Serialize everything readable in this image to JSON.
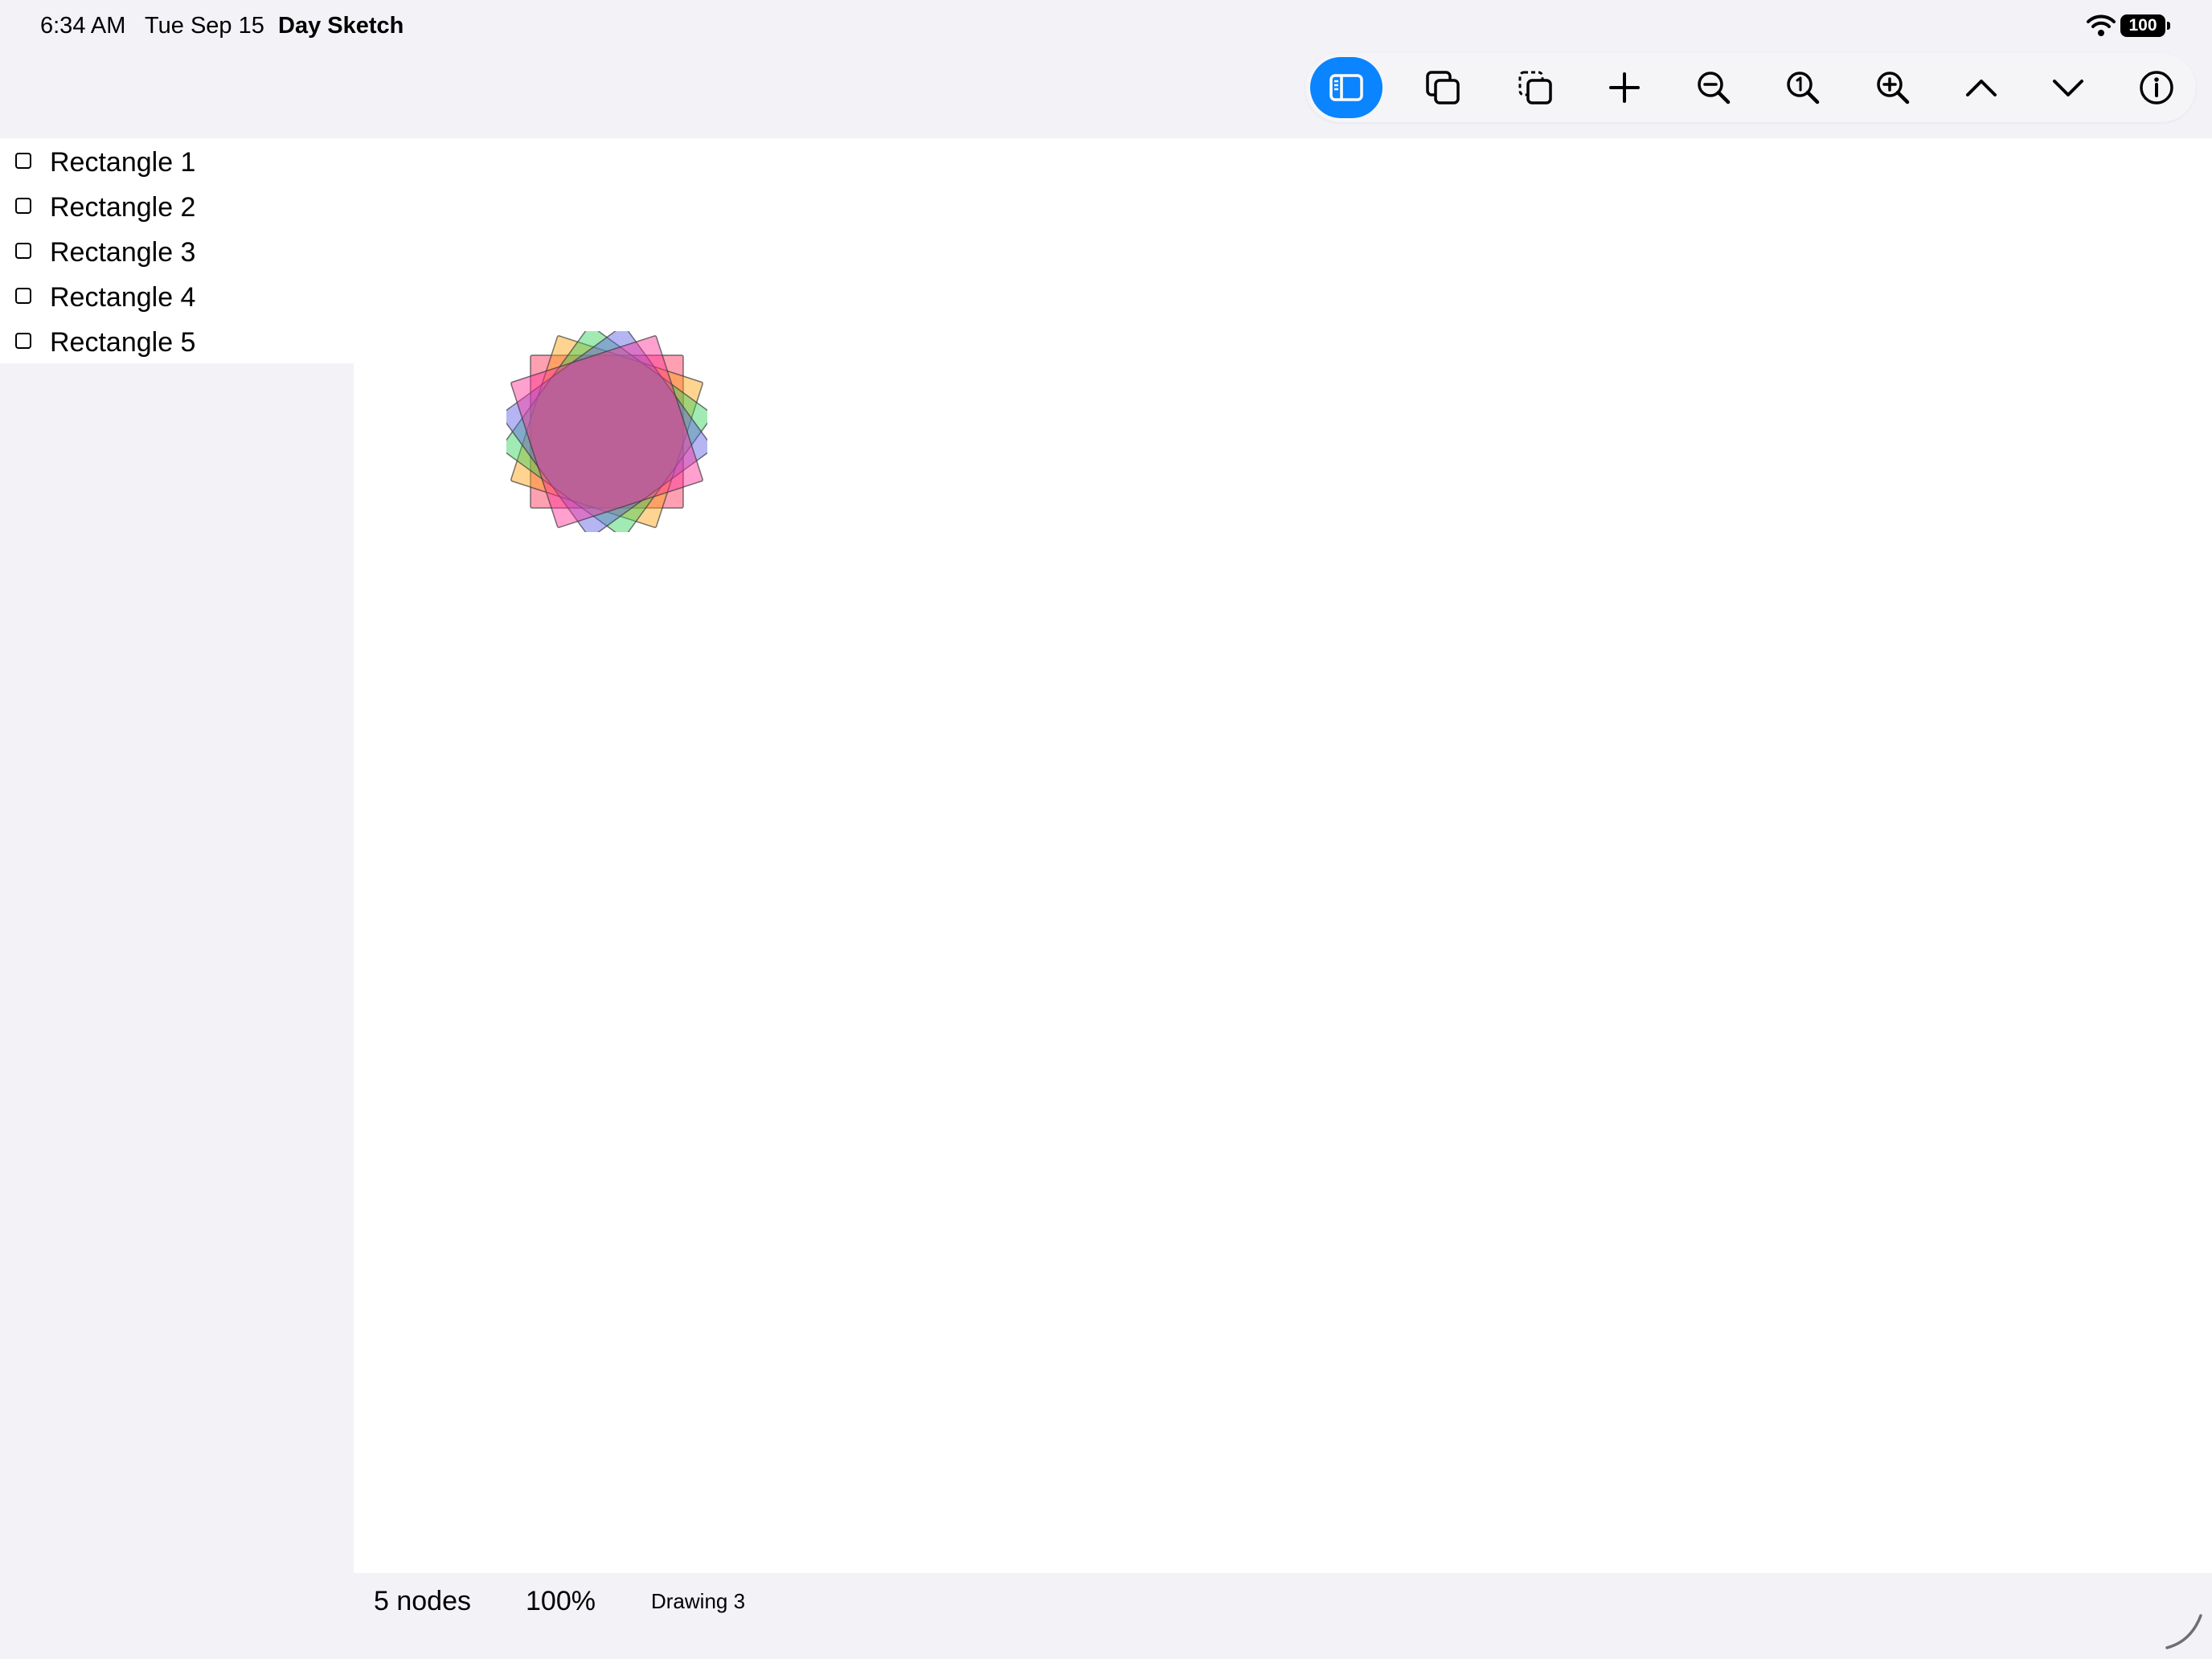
{
  "status_bar": {
    "time": "6:34 AM",
    "date": "Tue Sep 15",
    "app_name": "Day Sketch",
    "battery": "100"
  },
  "toolbar": {
    "buttons": [
      {
        "icon": "sidebar-toggle-icon",
        "active": true
      },
      {
        "icon": "duplicate-icon",
        "active": false
      },
      {
        "icon": "selection-copy-icon",
        "active": false
      },
      {
        "icon": "plus-icon",
        "active": false
      },
      {
        "icon": "zoom-out-icon",
        "active": false
      },
      {
        "icon": "zoom-actual-size-icon",
        "active": false
      },
      {
        "icon": "zoom-in-icon",
        "active": false
      },
      {
        "icon": "chevron-up-icon",
        "active": false
      },
      {
        "icon": "chevron-down-icon",
        "active": false
      },
      {
        "icon": "info-icon",
        "active": false
      }
    ],
    "accent_color": "#0a84ff"
  },
  "sidebar": {
    "layers": [
      {
        "label": "Rectangle 1",
        "icon": "rectangle-icon"
      },
      {
        "label": "Rectangle 2",
        "icon": "rectangle-icon"
      },
      {
        "label": "Rectangle 3",
        "icon": "rectangle-icon"
      },
      {
        "label": "Rectangle 4",
        "icon": "rectangle-icon"
      },
      {
        "label": "Rectangle 5",
        "icon": "rectangle-icon"
      }
    ]
  },
  "canvas": {
    "shapes": [
      {
        "name": "Rectangle 1",
        "fill": "#ff2d55",
        "rotation_deg": 0
      },
      {
        "name": "Rectangle 2",
        "fill": "#ff9f0a",
        "rotation_deg": 18
      },
      {
        "name": "Rectangle 3",
        "fill": "#30d158",
        "rotation_deg": 36
      },
      {
        "name": "Rectangle 4",
        "fill": "#5e5ce6",
        "rotation_deg": 54
      },
      {
        "name": "Rectangle 5",
        "fill": "#ff2d95",
        "rotation_deg": 72
      }
    ]
  },
  "footer": {
    "node_count": "5 nodes",
    "zoom": "100%",
    "document_name": "Drawing 3"
  }
}
